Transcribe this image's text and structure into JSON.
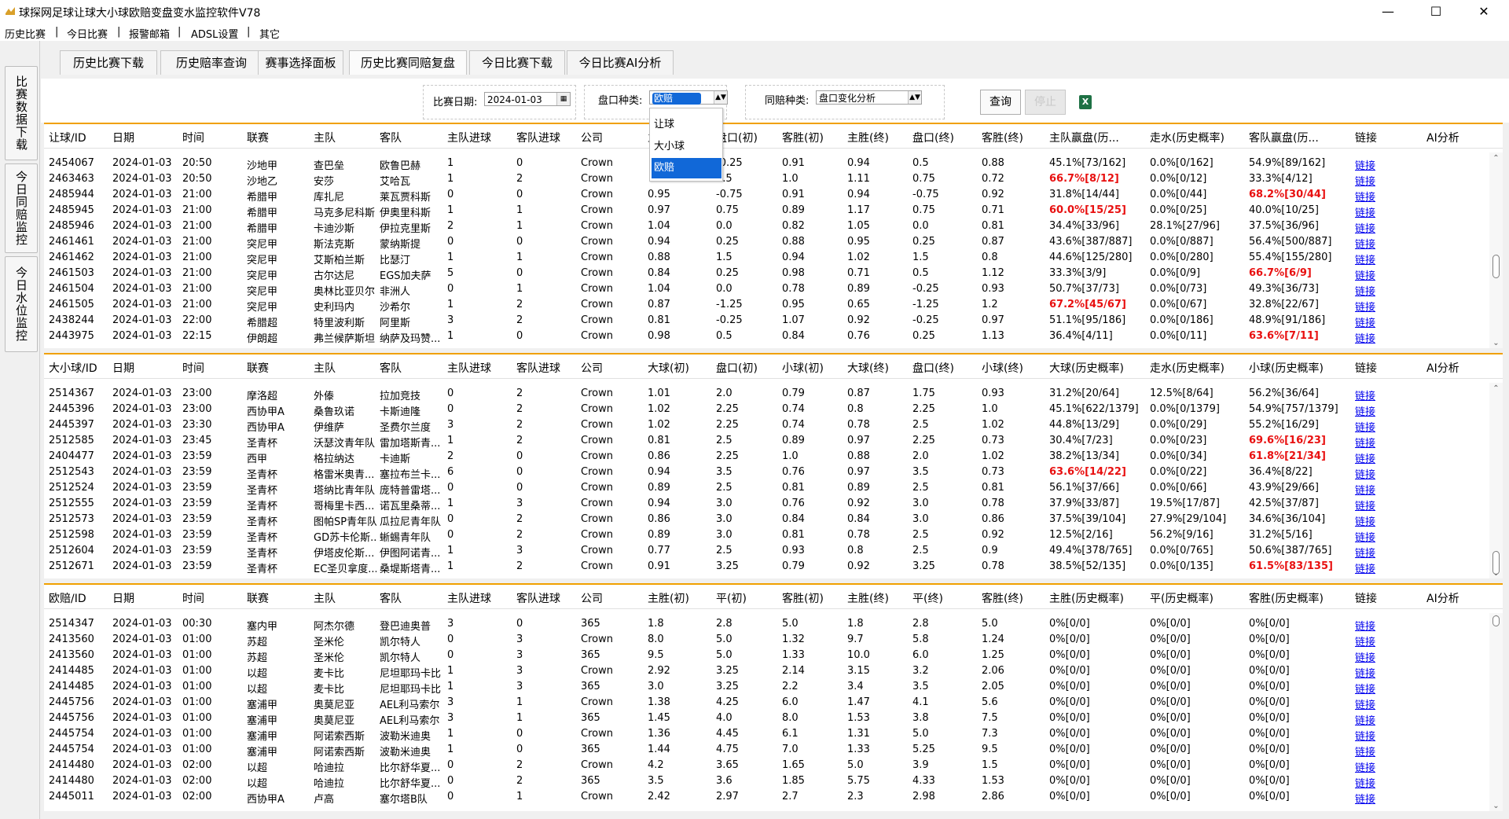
{
  "window": {
    "title": "球探网足球让球大小球欧赔变盘变水监控软件V78",
    "minimize": "—",
    "maximize": "☐",
    "close": "✕"
  },
  "menu": [
    "历史比赛",
    "今日比赛",
    "报警邮箱",
    "ADSL设置",
    "其它"
  ],
  "menu_sep": "|",
  "left_tabs": [
    "比赛数据下载",
    "今日同赔监控",
    "今日水位监控"
  ],
  "top_tabs": [
    "历史比赛下载",
    "历史赔率查询",
    "赛事选择面板",
    "历史比赛同赔复盘",
    "今日比赛下载",
    "今日比赛AI分析"
  ],
  "active_top_tab": 3,
  "toolbar": {
    "date_label": "比赛日期:",
    "date_value": "2024-01-03",
    "market_label": "盘口种类:",
    "market_value": "欧赔",
    "same_label": "同赔种类:",
    "same_value": "盘口变化分析",
    "query_button": "查询",
    "stop_button": "停止",
    "excel_icon": "X"
  },
  "dropdown": {
    "options": [
      "让球",
      "大小球",
      "欧赔"
    ],
    "selected": 2
  },
  "grids": [
    {
      "headers": [
        "让球/ID",
        "日期",
        "时间",
        "联赛",
        "主队",
        "客队",
        "主队进球",
        "客队进球",
        "公司",
        "主胜(初)",
        "盘口(初)",
        "客胜(初)",
        "主胜(终)",
        "盘口(终)",
        "客胜(终)",
        "主队赢盘(历...",
        "走水(历史概率)",
        "客队赢盘(历...",
        "链接",
        "AI分析"
      ],
      "rows": [
        [
          "2454067",
          "2024-01-03",
          "20:50",
          "沙地甲",
          "查巴垒",
          "欧鲁巴赫",
          "1",
          "0",
          "Crown",
          "",
          "-0.25",
          "0.91",
          "0.94",
          "0.5",
          "0.88",
          "45.1%[73/162]",
          "0.0%[0/162]",
          "54.9%[89/162]",
          "链接"
        ],
        [
          "2463463",
          "2024-01-03",
          "20:50",
          "沙地乙",
          "安莎",
          "艾哈瓦",
          "1",
          "2",
          "Crown",
          "",
          "0.5",
          "1.0",
          "1.11",
          "0.75",
          "0.72",
          "66.7%[8/12]",
          "0.0%[0/12]",
          "33.3%[4/12]",
          "链接"
        ],
        [
          "2485944",
          "2024-01-03",
          "21:00",
          "希腊甲",
          "库扎尼",
          "莱瓦贾科斯",
          "0",
          "0",
          "Crown",
          "0.95",
          "-0.75",
          "0.91",
          "0.94",
          "-0.75",
          "0.92",
          "31.8%[14/44]",
          "0.0%[0/44]",
          "68.2%[30/44]",
          "链接"
        ],
        [
          "2485945",
          "2024-01-03",
          "21:00",
          "希腊甲",
          "马克多尼科斯",
          "伊奥里科斯",
          "1",
          "1",
          "Crown",
          "0.97",
          "0.75",
          "0.89",
          "1.17",
          "0.75",
          "0.71",
          "60.0%[15/25]",
          "0.0%[0/25]",
          "40.0%[10/25]",
          "链接"
        ],
        [
          "2485946",
          "2024-01-03",
          "21:00",
          "希腊甲",
          "卡迪沙斯",
          "伊拉克里斯",
          "2",
          "1",
          "Crown",
          "1.04",
          "0.0",
          "0.82",
          "1.05",
          "0.0",
          "0.81",
          "34.4%[33/96]",
          "28.1%[27/96]",
          "37.5%[36/96]",
          "链接"
        ],
        [
          "2461461",
          "2024-01-03",
          "21:00",
          "突尼甲",
          "斯法克斯",
          "蒙纳斯提",
          "0",
          "0",
          "Crown",
          "0.94",
          "0.25",
          "0.88",
          "0.95",
          "0.25",
          "0.87",
          "43.6%[387/887]",
          "0.0%[0/887]",
          "56.4%[500/887]",
          "链接"
        ],
        [
          "2461462",
          "2024-01-03",
          "21:00",
          "突尼甲",
          "艾斯柏兰斯",
          "比瑟汀",
          "1",
          "1",
          "Crown",
          "0.88",
          "1.5",
          "0.94",
          "1.02",
          "1.5",
          "0.8",
          "44.6%[125/280]",
          "0.0%[0/280]",
          "55.4%[155/280]",
          "链接"
        ],
        [
          "2461503",
          "2024-01-03",
          "21:00",
          "突尼甲",
          "古尔达尼",
          "EGS加夫萨",
          "5",
          "0",
          "Crown",
          "0.84",
          "0.25",
          "0.98",
          "0.71",
          "0.5",
          "1.12",
          "33.3%[3/9]",
          "0.0%[0/9]",
          "66.7%[6/9]",
          "链接"
        ],
        [
          "2461504",
          "2024-01-03",
          "21:00",
          "突尼甲",
          "奥林比亚贝尔",
          "非洲人",
          "0",
          "1",
          "Crown",
          "1.04",
          "0.0",
          "0.78",
          "0.89",
          "-0.25",
          "0.93",
          "50.7%[37/73]",
          "0.0%[0/73]",
          "49.3%[36/73]",
          "链接"
        ],
        [
          "2461505",
          "2024-01-03",
          "21:00",
          "突尼甲",
          "史利玛内",
          "沙希尔",
          "1",
          "2",
          "Crown",
          "0.87",
          "-1.25",
          "0.95",
          "0.65",
          "-1.25",
          "1.2",
          "67.2%[45/67]",
          "0.0%[0/67]",
          "32.8%[22/67]",
          "链接"
        ],
        [
          "2438244",
          "2024-01-03",
          "22:00",
          "希腊超",
          "特里波利斯",
          "阿里斯",
          "3",
          "2",
          "Crown",
          "0.81",
          "-0.25",
          "1.07",
          "0.92",
          "-0.25",
          "0.97",
          "51.1%[95/186]",
          "0.0%[0/186]",
          "48.9%[91/186]",
          "链接"
        ],
        [
          "2443975",
          "2024-01-03",
          "22:15",
          "伊朗超",
          "弗兰候萨斯坦",
          "纳萨及玛赞...",
          "1",
          "0",
          "Crown",
          "0.98",
          "0.5",
          "0.84",
          "0.76",
          "0.25",
          "1.13",
          "36.4%[4/11]",
          "0.0%[0/11]",
          "63.6%[7/11]",
          "链接"
        ]
      ],
      "red": [
        [
          1,
          15
        ],
        [
          2,
          17
        ],
        [
          3,
          15
        ],
        [
          7,
          17
        ],
        [
          9,
          15
        ],
        [
          11,
          17
        ]
      ]
    },
    {
      "headers": [
        "大小球/ID",
        "日期",
        "时间",
        "联赛",
        "主队",
        "客队",
        "主队进球",
        "客队进球",
        "公司",
        "大球(初)",
        "盘口(初)",
        "小球(初)",
        "大球(终)",
        "盘口(终)",
        "小球(终)",
        "大球(历史概率)",
        "走水(历史概率)",
        "小球(历史概率)",
        "链接",
        "AI分析"
      ],
      "rows": [
        [
          "2514367",
          "2024-01-03",
          "23:00",
          "摩洛超",
          "外傣",
          "拉加竞技",
          "0",
          "2",
          "Crown",
          "1.01",
          "2.0",
          "0.79",
          "0.87",
          "1.75",
          "0.93",
          "31.2%[20/64]",
          "12.5%[8/64]",
          "56.2%[36/64]",
          "链接"
        ],
        [
          "2445396",
          "2024-01-03",
          "23:00",
          "西协甲A",
          "桑鲁玖诺",
          "卡斯迪隆",
          "0",
          "2",
          "Crown",
          "1.02",
          "2.25",
          "0.74",
          "0.8",
          "2.25",
          "1.0",
          "45.1%[622/1379]",
          "0.0%[0/1379]",
          "54.9%[757/1379]",
          "链接"
        ],
        [
          "2445397",
          "2024-01-03",
          "23:30",
          "西协甲A",
          "伊维萨",
          "圣费尔兰度",
          "3",
          "2",
          "Crown",
          "1.02",
          "2.25",
          "0.74",
          "0.78",
          "2.5",
          "1.02",
          "44.8%[13/29]",
          "0.0%[0/29]",
          "55.2%[16/29]",
          "链接"
        ],
        [
          "2512585",
          "2024-01-03",
          "23:45",
          "圣青杯",
          "沃瑟汶青年队",
          "雷加塔斯青...",
          "1",
          "2",
          "Crown",
          "0.81",
          "2.5",
          "0.89",
          "0.97",
          "2.25",
          "0.73",
          "30.4%[7/23]",
          "0.0%[0/23]",
          "69.6%[16/23]",
          "链接"
        ],
        [
          "2404477",
          "2024-01-03",
          "23:59",
          "西甲",
          "格拉纳达",
          "卡迪斯",
          "2",
          "0",
          "Crown",
          "0.86",
          "2.25",
          "1.0",
          "0.88",
          "2.0",
          "1.02",
          "38.2%[13/34]",
          "0.0%[0/34]",
          "61.8%[21/34]",
          "链接"
        ],
        [
          "2512543",
          "2024-01-03",
          "23:59",
          "圣青杯",
          "格雷米奥青...",
          "塞拉布兰卡...",
          "6",
          "0",
          "Crown",
          "0.94",
          "3.5",
          "0.76",
          "0.97",
          "3.5",
          "0.73",
          "63.6%[14/22]",
          "0.0%[0/22]",
          "36.4%[8/22]",
          "链接"
        ],
        [
          "2512524",
          "2024-01-03",
          "23:59",
          "圣青杯",
          "塔纳比青年队",
          "庞特普雷塔...",
          "0",
          "0",
          "Crown",
          "0.89",
          "2.5",
          "0.81",
          "0.89",
          "2.5",
          "0.81",
          "56.1%[37/66]",
          "0.0%[0/66]",
          "43.9%[29/66]",
          "链接"
        ],
        [
          "2512555",
          "2024-01-03",
          "23:59",
          "圣青杯",
          "哥梅里卡西...",
          "诺瓦里桑蒂...",
          "1",
          "3",
          "Crown",
          "0.94",
          "3.0",
          "0.76",
          "0.92",
          "3.0",
          "0.78",
          "37.9%[33/87]",
          "19.5%[17/87]",
          "42.5%[37/87]",
          "链接"
        ],
        [
          "2512573",
          "2024-01-03",
          "23:59",
          "圣青杯",
          "图帕SP青年队",
          "瓜拉尼青年队",
          "0",
          "2",
          "Crown",
          "0.86",
          "3.0",
          "0.84",
          "0.84",
          "3.0",
          "0.86",
          "37.5%[39/104]",
          "27.9%[29/104]",
          "34.6%[36/104]",
          "链接"
        ],
        [
          "2512598",
          "2024-01-03",
          "23:59",
          "圣青杯",
          "GD苏卡伦斯...",
          "蜥蜴青年队",
          "0",
          "2",
          "Crown",
          "0.89",
          "3.0",
          "0.81",
          "0.78",
          "2.5",
          "0.92",
          "12.5%[2/16]",
          "56.2%[9/16]",
          "31.2%[5/16]",
          "链接"
        ],
        [
          "2512604",
          "2024-01-03",
          "23:59",
          "圣青杯",
          "伊塔皮伦斯...",
          "伊图阿诺青...",
          "1",
          "3",
          "Crown",
          "0.77",
          "2.5",
          "0.93",
          "0.8",
          "2.5",
          "0.9",
          "49.4%[378/765]",
          "0.0%[0/765]",
          "50.6%[387/765]",
          "链接"
        ],
        [
          "2512671",
          "2024-01-03",
          "23:59",
          "圣青杯",
          "EC圣贝拿度...",
          "桑堤斯塔青...",
          "1",
          "2",
          "Crown",
          "0.91",
          "3.25",
          "0.79",
          "0.92",
          "3.25",
          "0.78",
          "38.5%[52/135]",
          "0.0%[0/135]",
          "61.5%[83/135]",
          "链接"
        ]
      ],
      "red": [
        [
          3,
          17
        ],
        [
          4,
          17
        ],
        [
          5,
          15
        ],
        [
          11,
          17
        ]
      ]
    },
    {
      "headers": [
        "欧赔/ID",
        "日期",
        "时间",
        "联赛",
        "主队",
        "客队",
        "主队进球",
        "客队进球",
        "公司",
        "主胜(初)",
        "平(初)",
        "客胜(初)",
        "主胜(终)",
        "平(终)",
        "客胜(终)",
        "主胜(历史概率)",
        "平(历史概率)",
        "客胜(历史概率)",
        "链接",
        "AI分析"
      ],
      "rows": [
        [
          "2514347",
          "2024-01-03",
          "00:30",
          "塞内甲",
          "阿杰尔德",
          "登巴迪奥普",
          "3",
          "0",
          "365",
          "1.8",
          "2.8",
          "5.0",
          "1.8",
          "2.8",
          "5.0",
          "0%[0/0]",
          "0%[0/0]",
          "0%[0/0]",
          "链接"
        ],
        [
          "2413560",
          "2024-01-03",
          "01:00",
          "苏超",
          "圣米伦",
          "凯尔特人",
          "0",
          "3",
          "Crown",
          "8.0",
          "5.0",
          "1.32",
          "9.7",
          "5.8",
          "1.24",
          "0%[0/0]",
          "0%[0/0]",
          "0%[0/0]",
          "链接"
        ],
        [
          "2413560",
          "2024-01-03",
          "01:00",
          "苏超",
          "圣米伦",
          "凯尔特人",
          "0",
          "3",
          "365",
          "9.5",
          "5.0",
          "1.33",
          "10.0",
          "6.0",
          "1.25",
          "0%[0/0]",
          "0%[0/0]",
          "0%[0/0]",
          "链接"
        ],
        [
          "2414485",
          "2024-01-03",
          "01:00",
          "以超",
          "麦卡比",
          "尼坦耶玛卡比",
          "1",
          "3",
          "Crown",
          "2.92",
          "3.25",
          "2.14",
          "3.15",
          "3.2",
          "2.06",
          "0%[0/0]",
          "0%[0/0]",
          "0%[0/0]",
          "链接"
        ],
        [
          "2414485",
          "2024-01-03",
          "01:00",
          "以超",
          "麦卡比",
          "尼坦耶玛卡比",
          "1",
          "3",
          "365",
          "3.0",
          "3.25",
          "2.2",
          "3.4",
          "3.5",
          "2.05",
          "0%[0/0]",
          "0%[0/0]",
          "0%[0/0]",
          "链接"
        ],
        [
          "2445756",
          "2024-01-03",
          "01:00",
          "塞浦甲",
          "奥莫尼亚",
          "AEL利马索尔",
          "3",
          "1",
          "Crown",
          "1.38",
          "4.25",
          "6.0",
          "1.47",
          "4.1",
          "5.6",
          "0%[0/0]",
          "0%[0/0]",
          "0%[0/0]",
          "链接"
        ],
        [
          "2445756",
          "2024-01-03",
          "01:00",
          "塞浦甲",
          "奥莫尼亚",
          "AEL利马索尔",
          "3",
          "1",
          "365",
          "1.45",
          "4.0",
          "8.0",
          "1.53",
          "3.8",
          "7.5",
          "0%[0/0]",
          "0%[0/0]",
          "0%[0/0]",
          "链接"
        ],
        [
          "2445754",
          "2024-01-03",
          "01:00",
          "塞浦甲",
          "阿诺索西斯",
          "波勒米迪奥",
          "1",
          "0",
          "Crown",
          "1.36",
          "4.45",
          "6.1",
          "1.31",
          "5.0",
          "7.3",
          "0%[0/0]",
          "0%[0/0]",
          "0%[0/0]",
          "链接"
        ],
        [
          "2445754",
          "2024-01-03",
          "01:00",
          "塞浦甲",
          "阿诺索西斯",
          "波勒米迪奥",
          "1",
          "0",
          "365",
          "1.44",
          "4.75",
          "7.0",
          "1.33",
          "5.25",
          "9.5",
          "0%[0/0]",
          "0%[0/0]",
          "0%[0/0]",
          "链接"
        ],
        [
          "2414480",
          "2024-01-03",
          "02:00",
          "以超",
          "哈迪拉",
          "比尔舒华夏...",
          "0",
          "2",
          "Crown",
          "4.2",
          "3.65",
          "1.65",
          "5.0",
          "3.9",
          "1.5",
          "0%[0/0]",
          "0%[0/0]",
          "0%[0/0]",
          "链接"
        ],
        [
          "2414480",
          "2024-01-03",
          "02:00",
          "以超",
          "哈迪拉",
          "比尔舒华夏...",
          "0",
          "2",
          "365",
          "3.5",
          "3.6",
          "1.85",
          "5.75",
          "4.33",
          "1.53",
          "0%[0/0]",
          "0%[0/0]",
          "0%[0/0]",
          "链接"
        ],
        [
          "2445011",
          "2024-01-03",
          "02:00",
          "西协甲A",
          "卢高",
          "塞尔塔B队",
          "0",
          "1",
          "Crown",
          "2.42",
          "2.97",
          "2.7",
          "2.3",
          "2.98",
          "2.86",
          "0%[0/0]",
          "0%[0/0]",
          "0%[0/0]",
          "链接"
        ]
      ],
      "red": []
    }
  ]
}
